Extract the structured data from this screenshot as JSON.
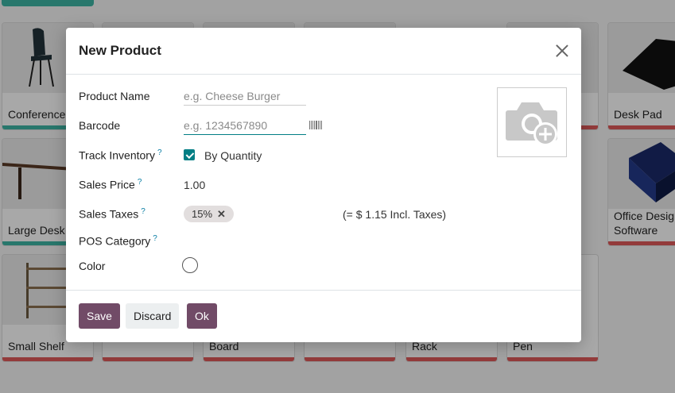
{
  "background": {
    "cards": [
      {
        "name": "Conference Chair",
        "bar": "teal"
      },
      {
        "name": "",
        "bar": "red"
      },
      {
        "name": "",
        "bar": "red"
      },
      {
        "name": "",
        "bar": "red"
      },
      {
        "name": "",
        "bar": "red"
      },
      {
        "name": "Desk Pad",
        "bar": "red"
      },
      {
        "name": "Large Desk",
        "bar": "teal"
      },
      {
        "name": "Office Design Software",
        "bar": "red"
      },
      {
        "name": "Small Shelf",
        "bar": "red"
      },
      {
        "name": "Board",
        "bar": "red"
      },
      {
        "name": "Rack",
        "bar": "red"
      },
      {
        "name": "Pen",
        "bar": "red"
      }
    ]
  },
  "modal": {
    "title": "New Product",
    "fields": {
      "product_name": {
        "label": "Product Name",
        "placeholder": "e.g. Cheese Burger",
        "value": ""
      },
      "barcode": {
        "label": "Barcode",
        "placeholder": "e.g. 1234567890",
        "value": ""
      },
      "track_inventory": {
        "label": "Track Inventory",
        "help": "?",
        "option": "By Quantity",
        "checked": true
      },
      "sales_price": {
        "label": "Sales Price",
        "help": "?",
        "value": "1.00"
      },
      "sales_taxes": {
        "label": "Sales Taxes",
        "help": "?",
        "tag": "15%",
        "incl_text": "(= $ 1.15 Incl. Taxes)"
      },
      "pos_category": {
        "label": "POS Category",
        "help": "?"
      },
      "color": {
        "label": "Color"
      }
    },
    "buttons": {
      "save": "Save",
      "discard": "Discard",
      "ok": "Ok"
    },
    "colors": {
      "primary": "#714b67",
      "accent": "#017e84"
    }
  }
}
